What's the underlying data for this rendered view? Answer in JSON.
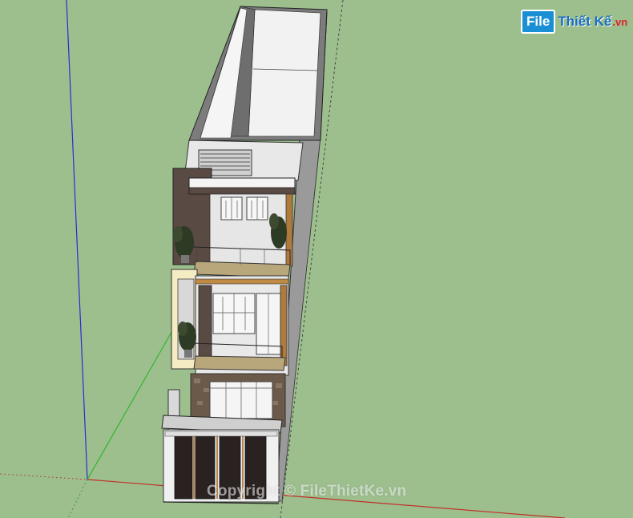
{
  "logo": {
    "brand_box": "File",
    "brand_text": "Thiết Kế",
    "brand_ext": ".vn",
    "brand_color": "#1a8fd6",
    "brand_ext_color": "#e0202a"
  },
  "watermark": {
    "text": "Copyright © FileThietKe.vn"
  },
  "scene": {
    "background_color": "#9dbf8e",
    "axis_colors": {
      "red": "#c0312a",
      "green": "#2db82d",
      "blue": "#2b2bd6"
    }
  }
}
